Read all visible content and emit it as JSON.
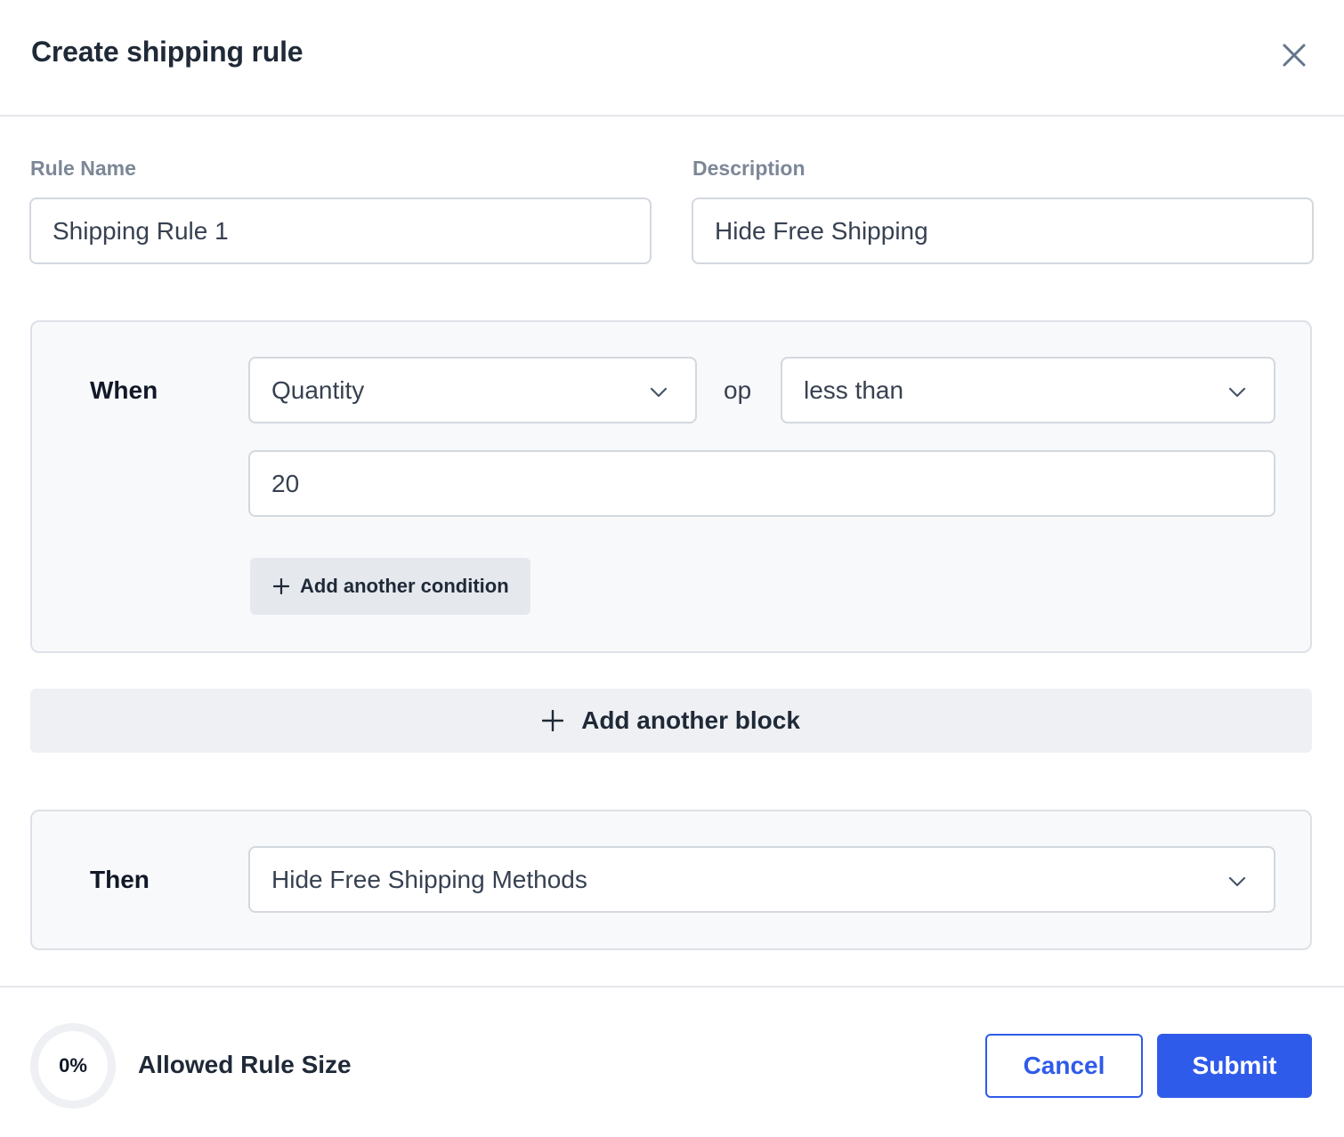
{
  "header": {
    "title": "Create shipping rule",
    "close_icon": "close-icon"
  },
  "form": {
    "rule_name": {
      "label": "Rule Name",
      "value": "Shipping Rule 1"
    },
    "description": {
      "label": "Description",
      "value": "Hide Free Shipping"
    }
  },
  "when_block": {
    "label": "When",
    "field_select": {
      "value": "Quantity"
    },
    "op_label": "op",
    "operator_select": {
      "value": "less than"
    },
    "value_input": {
      "value": "20"
    },
    "add_condition_label": "Add another condition"
  },
  "add_block_label": "Add another block",
  "then_block": {
    "label": "Then",
    "action_select": {
      "value": "Hide Free Shipping Methods"
    }
  },
  "footer": {
    "rule_size_percent": "0%",
    "rule_size_fraction": 0,
    "rule_size_label": "Allowed Rule Size",
    "cancel_label": "Cancel",
    "submit_label": "Submit"
  },
  "colors": {
    "accent": "#2f5bea",
    "label": "#7c8797",
    "border": "#d3d8df"
  }
}
